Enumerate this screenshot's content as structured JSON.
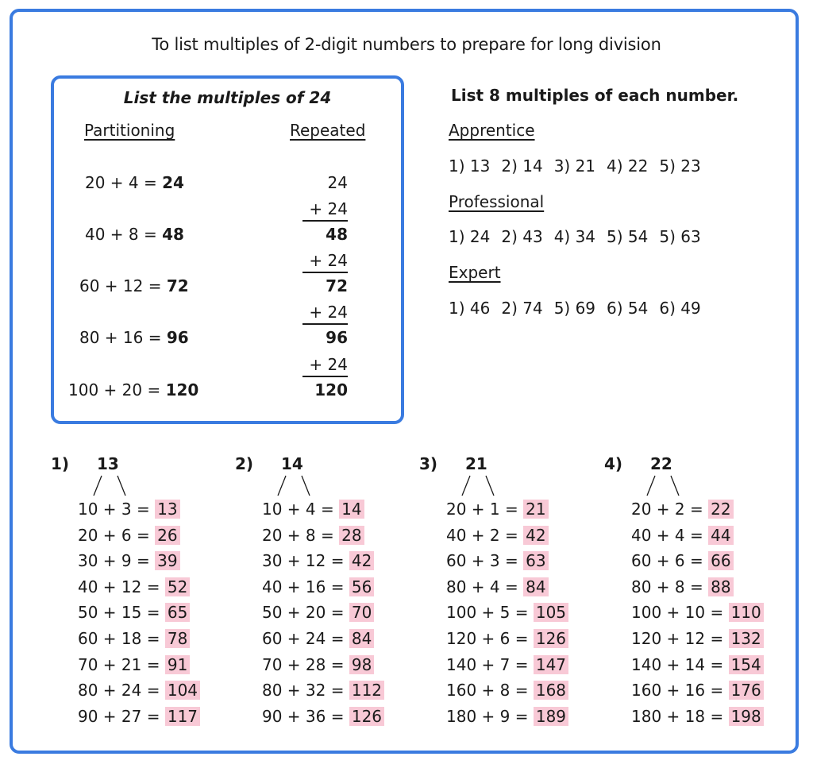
{
  "title": "To list multiples of 2-digit numbers to prepare for long division",
  "example": {
    "title": "List the multiples of 24",
    "partitioning_label": "Partitioning",
    "repeated_label": "Repeated",
    "partitioning": [
      {
        "expr": "20 + 4 = ",
        "result": "24"
      },
      {
        "expr": "40 + 8 = ",
        "result": "48"
      },
      {
        "expr": "60 + 12 = ",
        "result": "72"
      },
      {
        "expr": "80 + 16 = ",
        "result": "96"
      },
      {
        "expr": "100 + 20 = ",
        "result": "120"
      }
    ],
    "repeated": {
      "start": "24",
      "addend": "+ 24",
      "totals": [
        "48",
        "72",
        "96",
        "120"
      ]
    }
  },
  "task": {
    "heading": "List 8 multiples of each number.",
    "levels": [
      {
        "name": "Apprentice",
        "items": [
          "1) 13",
          "2) 14",
          "3) 21",
          "4) 22",
          "5) 23"
        ]
      },
      {
        "name": "Professional",
        "items": [
          "1) 24",
          "2) 43",
          "4) 34",
          "5) 54",
          "5) 63"
        ]
      },
      {
        "name": "Expert",
        "items": [
          "1) 46",
          "2) 74",
          "5) 69",
          "6) 54",
          "6) 49"
        ]
      }
    ]
  },
  "highlight_color": "#f8c9d6",
  "accent_color": "#3a7be0",
  "worked_examples": [
    {
      "label": "1)",
      "number": "13",
      "rows": [
        {
          "expr": "10 + 3 = ",
          "result": "13"
        },
        {
          "expr": "20 + 6 = ",
          "result": "26"
        },
        {
          "expr": "30 + 9 = ",
          "result": "39"
        },
        {
          "expr": "40 + 12 = ",
          "result": "52"
        },
        {
          "expr": "50 + 15 = ",
          "result": "65"
        },
        {
          "expr": "60 + 18 = ",
          "result": "78"
        },
        {
          "expr": "70 + 21 = ",
          "result": "91"
        },
        {
          "expr": "80 + 24 = ",
          "result": "104"
        },
        {
          "expr": "90 + 27 = ",
          "result": "117"
        }
      ]
    },
    {
      "label": "2)",
      "number": "14",
      "rows": [
        {
          "expr": "10 + 4 = ",
          "result": "14"
        },
        {
          "expr": "20 + 8 = ",
          "result": "28"
        },
        {
          "expr": "30 + 12 = ",
          "result": "42"
        },
        {
          "expr": "40 + 16 = ",
          "result": "56"
        },
        {
          "expr": "50 + 20 = ",
          "result": "70"
        },
        {
          "expr": "60 + 24 = ",
          "result": "84"
        },
        {
          "expr": "70 + 28 = ",
          "result": "98"
        },
        {
          "expr": "80 + 32 = ",
          "result": "112"
        },
        {
          "expr": "90 + 36 = ",
          "result": "126"
        }
      ]
    },
    {
      "label": "3)",
      "number": "21",
      "rows": [
        {
          "expr": "20 + 1 = ",
          "result": "21"
        },
        {
          "expr": "40 + 2 = ",
          "result": "42"
        },
        {
          "expr": "60 + 3 = ",
          "result": "63"
        },
        {
          "expr": "80 + 4 = ",
          "result": "84"
        },
        {
          "expr": "100 + 5 = ",
          "result": "105"
        },
        {
          "expr": "120 + 6 = ",
          "result": "126"
        },
        {
          "expr": "140 + 7 = ",
          "result": "147"
        },
        {
          "expr": "160 + 8 = ",
          "result": "168"
        },
        {
          "expr": "180 + 9 = ",
          "result": "189"
        }
      ]
    },
    {
      "label": "4)",
      "number": "22",
      "rows": [
        {
          "expr": "20 + 2 = ",
          "result": "22"
        },
        {
          "expr": "40 + 4 = ",
          "result": "44"
        },
        {
          "expr": "60 + 6 = ",
          "result": "66"
        },
        {
          "expr": "80 + 8 = ",
          "result": "88"
        },
        {
          "expr": "100 + 10 = ",
          "result": "110"
        },
        {
          "expr": "120 + 12 = ",
          "result": "132"
        },
        {
          "expr": "140 + 14 = ",
          "result": "154"
        },
        {
          "expr": "160 + 16 = ",
          "result": "176"
        },
        {
          "expr": "180 + 18 = ",
          "result": "198"
        }
      ]
    }
  ]
}
